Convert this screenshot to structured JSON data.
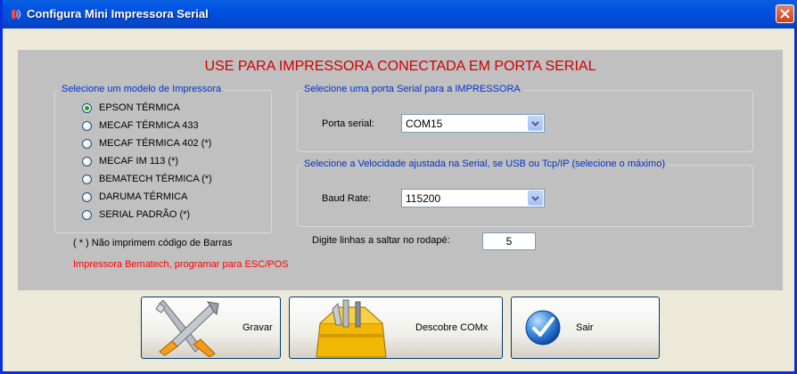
{
  "window": {
    "title": "Configura Mini Impressora Serial"
  },
  "headline": "USE PARA IMPRESSORA CONECTADA EM PORTA SERIAL",
  "printer_model": {
    "title": "Selecione um modelo de Impressora",
    "options": [
      {
        "label": "EPSON TÉRMICA",
        "checked": true
      },
      {
        "label": "MECAF TÉRMICA 433",
        "checked": false
      },
      {
        "label": "MECAF TÉRMICA 402 (*)",
        "checked": false
      },
      {
        "label": "MECAF IM 113 (*)",
        "checked": false
      },
      {
        "label": "BEMATECH TÉRMICA (*)",
        "checked": false
      },
      {
        "label": "DARUMA TÉRMICA",
        "checked": false
      },
      {
        "label": "SERIAL PADRÃO (*)",
        "checked": false
      }
    ]
  },
  "serial_port": {
    "title": "Selecione uma porta Serial  para a IMPRESSORA",
    "label": "Porta serial:",
    "value": "COM15"
  },
  "baud": {
    "title": "Selecione a Velocidade ajustada na Serial, se USB ou Tcp/IP (selecione o máximo)",
    "label": "Baud Rate:",
    "value": "115200"
  },
  "footer_lines": {
    "label": "Digite linhas a saltar no rodapé:",
    "value": "5"
  },
  "notes": {
    "barcode": "( * ) Não imprimem código de Barras",
    "bematech": "Impressora Bematech, programar para ESC/POS"
  },
  "buttons": {
    "save": "Gravar",
    "discover": "Descobre COMx",
    "exit": "Sair"
  },
  "colors": {
    "title_bar": "#0054e3",
    "panel": "#c0c0c0",
    "headline": "#d00000",
    "group_title": "#0033cc",
    "warning": "#ff0000"
  }
}
